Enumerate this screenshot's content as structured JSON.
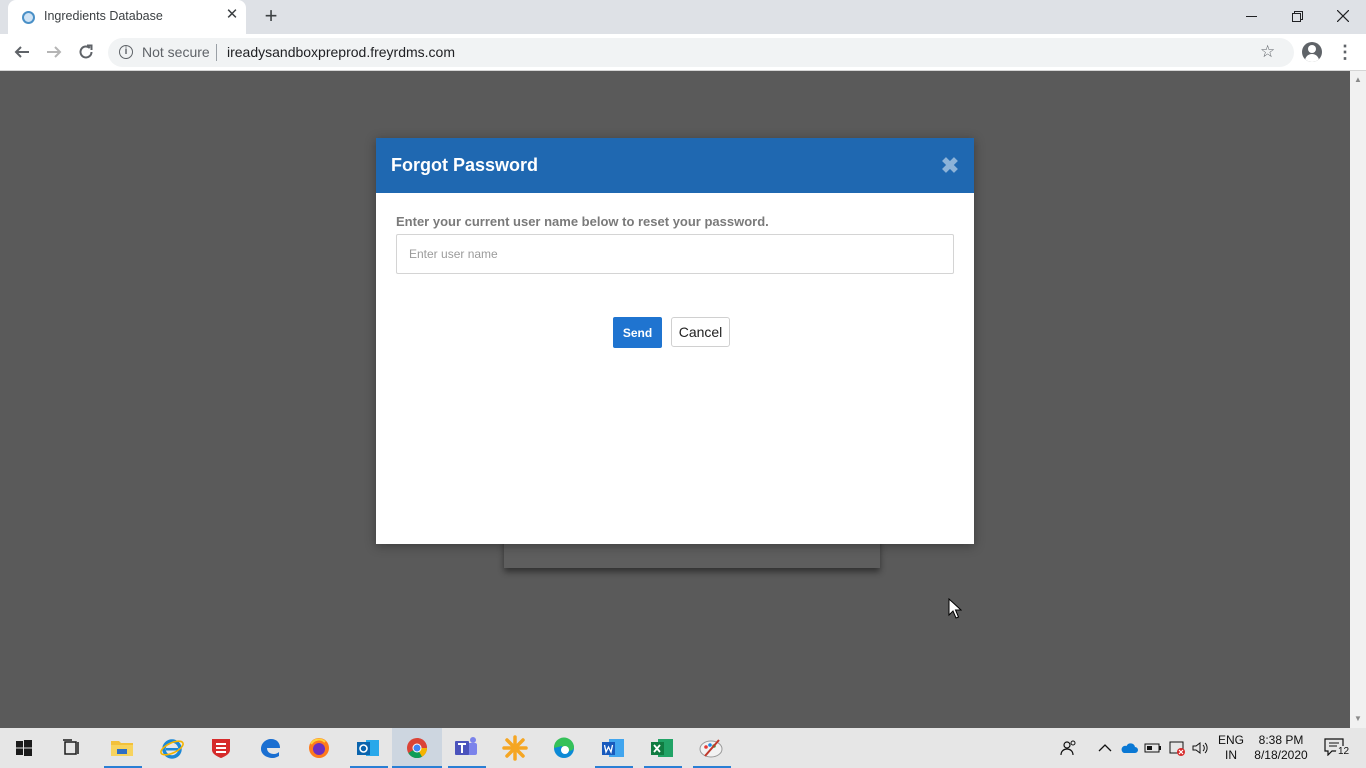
{
  "browser": {
    "tab_title": "Ingredients Database",
    "tab_close": "✕",
    "new_tab": "+",
    "security_label": "Not secure",
    "url": "ireadysandboxpreprod.freyrdms.com"
  },
  "modal": {
    "title": "Forgot Password",
    "close_label": "✖",
    "instruction": "Enter your current user name below to reset your password.",
    "username_placeholder": "Enter user name",
    "username_value": "",
    "send_label": "Send",
    "cancel_label": "Cancel",
    "header_color": "#1f68b1",
    "send_color": "#1f74d0"
  },
  "taskbar": {
    "apps": [
      "windows-start",
      "task-view",
      "file-explorer",
      "internet-explorer",
      "fortinet",
      "edge",
      "firefox",
      "outlook",
      "chrome",
      "teams",
      "asterisk-app",
      "edge-chromium",
      "word",
      "excel",
      "paint-app"
    ],
    "active_app": "chrome",
    "language_line1": "ENG",
    "language_line2": "IN",
    "time": "8:38 PM",
    "date": "8/18/2020",
    "notification_count": "12"
  }
}
